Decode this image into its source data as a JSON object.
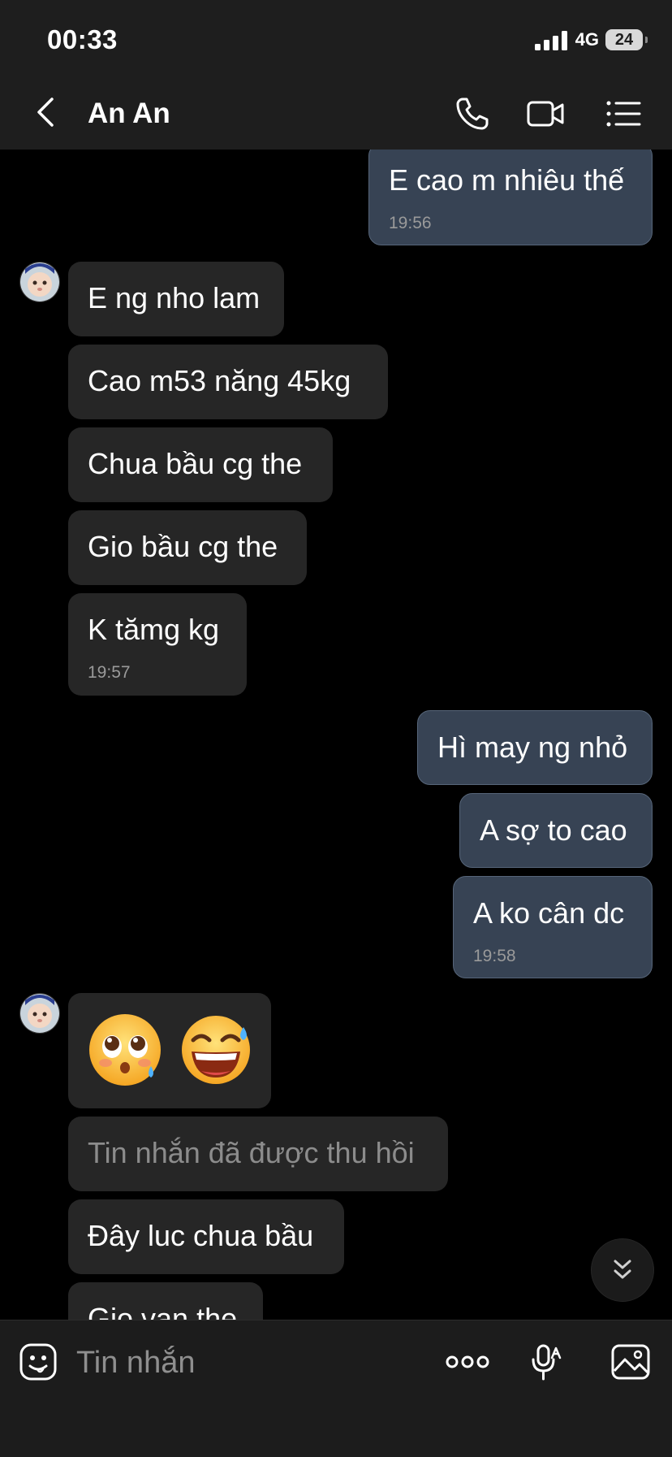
{
  "status_bar": {
    "time": "00:33",
    "network": "4G",
    "battery": "24"
  },
  "header": {
    "contact_name": "An An"
  },
  "icons": {
    "back": "chevron-left-icon",
    "call": "phone-icon",
    "video": "video-camera-icon",
    "menu": "list-icon",
    "sticker": "sticker-face-icon",
    "more": "more-dots-icon",
    "voice": "microphone-icon",
    "image": "image-icon",
    "scroll": "double-chevron-down-icon"
  },
  "messages": [
    {
      "dir": "out",
      "text": "E cao m nhiêu thế",
      "time": "19:56"
    },
    {
      "dir": "in",
      "text": "E ng nho lam"
    },
    {
      "dir": "in",
      "text": "Cao m53 năng 45kg"
    },
    {
      "dir": "in",
      "text": "Chua bầu cg the"
    },
    {
      "dir": "in",
      "text": "Gio bầu cg the"
    },
    {
      "dir": "in",
      "text": "K tămg kg",
      "time": "19:57"
    },
    {
      "dir": "out",
      "text": "Hì may ng nhỏ"
    },
    {
      "dir": "out",
      "text": "A sợ to cao"
    },
    {
      "dir": "out",
      "text": "A ko cân dc",
      "time": "19:58"
    },
    {
      "dir": "in",
      "stickers": [
        "pleading-face",
        "grinning-sweat-face"
      ]
    },
    {
      "dir": "in",
      "text": "Tin nhắn đã được thu hồi",
      "recalled": true
    },
    {
      "dir": "in",
      "text": "Đây luc chua bầu"
    },
    {
      "dir": "in",
      "text": "Gio van the"
    }
  ],
  "composer": {
    "placeholder": "Tin nhắn"
  },
  "colors": {
    "outgoing_bubble": "#374354",
    "incoming_bubble": "#262626",
    "bar_background": "#1e1e1e"
  }
}
